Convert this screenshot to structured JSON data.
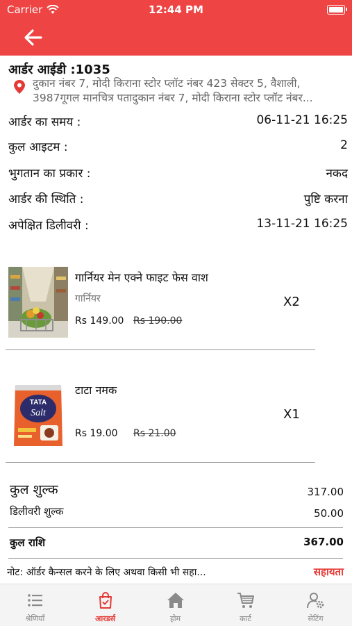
{
  "status_bar": {
    "carrier": "Carrier",
    "time": "12:44 PM"
  },
  "theme": {
    "primary": "#ee4444",
    "accent": "#e53935"
  },
  "order": {
    "id_label": "आर्डर आईडी :1035",
    "address_line1": "दुकान नंबर 7, मोदी किराना स्टोर प्लॉट नंबर 423 सेक्टर 5, वैशाली,",
    "address_line2": "3987गूगल मानचित्र पतादुकान नंबर 7, मोदी किराना स्टोर प्लॉट नंबर...",
    "details": [
      {
        "label": "आर्डर का समय :",
        "value": "06-11-21 16:25"
      },
      {
        "label": "कुल आइटम :",
        "value": "2"
      },
      {
        "label": "भुगतान का प्रकार :",
        "value": "नकद"
      },
      {
        "label": "आर्डर की स्थिति :",
        "value": "पुष्टि करना"
      },
      {
        "label": "अपेक्षित डिलीवरी :",
        "value": "13-11-21 16:25"
      }
    ]
  },
  "products": [
    {
      "name": "गार्नियर मेन एक्ने फाइट फेस वाश",
      "brand": "गार्नियर",
      "price": "Rs 149.00",
      "mrp": "Rs 190.00",
      "qty": "X2"
    },
    {
      "name": "टाटा नमक",
      "brand": "",
      "price": "Rs 19.00",
      "mrp": "Rs 21.00",
      "qty": "X1",
      "image_text_1": "TATA",
      "image_text_2": "Salt"
    }
  ],
  "summary": {
    "total_charge_label": "कुल शुल्क",
    "total_charge_value": "317.00",
    "delivery_label": "डिलीवरी शुल्क",
    "delivery_value": "50.00",
    "grand_total_label": "कुल राशि",
    "grand_total_value": "367.00"
  },
  "note": {
    "text": "नोट: ऑर्डर कैन्सल करने के लिए अथवा किसी भी सहा...",
    "help": "सहायता"
  },
  "tabs": [
    {
      "label": "श्रेणियाँ",
      "icon": "list-icon"
    },
    {
      "label": "आरडर्स",
      "icon": "bag-icon",
      "active": true
    },
    {
      "label": "होम",
      "icon": "home-icon"
    },
    {
      "label": "कार्ट",
      "icon": "cart-icon"
    },
    {
      "label": "सेटिंग",
      "icon": "user-settings-icon"
    }
  ]
}
